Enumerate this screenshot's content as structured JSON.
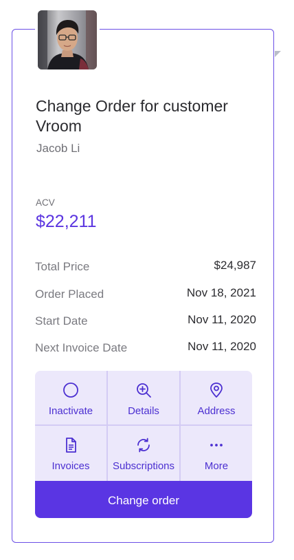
{
  "header": {
    "title": "Change Order for customer Vroom",
    "subtitle": "Jacob Li"
  },
  "acv": {
    "label": "ACV",
    "value": "$22,211"
  },
  "details": [
    {
      "label": "Total Price",
      "value": "$24,987"
    },
    {
      "label": "Order Placed",
      "value": "Nov 18, 2021"
    },
    {
      "label": "Start Date",
      "value": "Nov 11, 2020"
    },
    {
      "label": "Next Invoice Date",
      "value": "Nov 11, 2020"
    }
  ],
  "actions": [
    {
      "label": "Inactivate",
      "icon": "circle-icon"
    },
    {
      "label": "Details",
      "icon": "zoom-in-icon"
    },
    {
      "label": "Address",
      "icon": "map-pin-icon"
    },
    {
      "label": "Invoices",
      "icon": "document-icon"
    },
    {
      "label": "Subscriptions",
      "icon": "refresh-icon"
    },
    {
      "label": "More",
      "icon": "more-dots-icon"
    }
  ],
  "cta": {
    "label": "Change order"
  },
  "colors": {
    "accent": "#5a35e3",
    "accent_text": "#4b2fd1",
    "tile_bg": "#ece8fb",
    "border": "#6a4ee6"
  }
}
